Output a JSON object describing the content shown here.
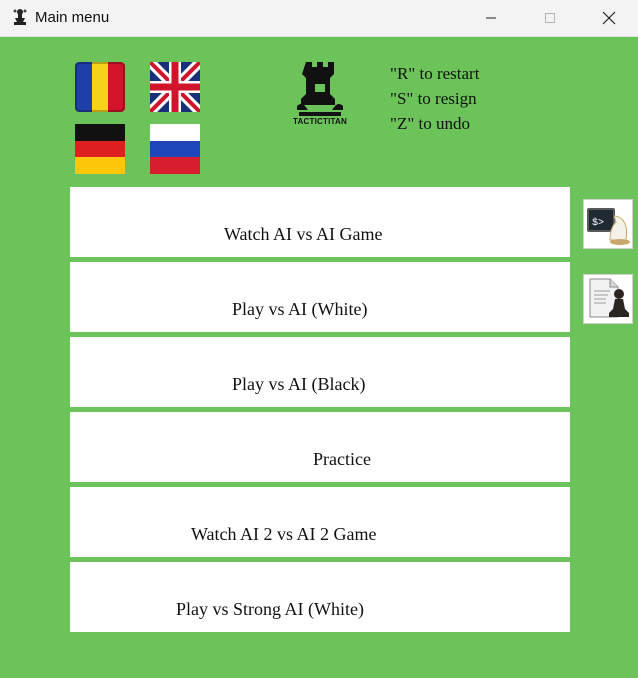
{
  "window": {
    "title": "Main menu",
    "controls": [
      "minimize",
      "maximize",
      "close"
    ]
  },
  "languages": [
    {
      "name": "romanian",
      "icon": "romania-flag-icon"
    },
    {
      "name": "english",
      "icon": "uk-flag-icon"
    },
    {
      "name": "german",
      "icon": "germany-flag-icon"
    },
    {
      "name": "russian",
      "icon": "russia-flag-icon"
    }
  ],
  "logo": {
    "text": "TACTICTITAN",
    "icon": "rook-icon"
  },
  "hints": [
    "\"R\" to restart",
    "\"S\" to resign",
    "\"Z\" to undo"
  ],
  "menu": [
    "Watch AI vs AI Game",
    "Play vs AI (White)",
    "Play vs AI (Black)",
    "Practice",
    "Watch AI 2 vs AI 2 Game",
    "Play vs Strong AI (White)"
  ],
  "side_buttons": [
    {
      "icon": "terminal-knight-icon"
    },
    {
      "icon": "document-pawn-icon"
    }
  ],
  "colors": {
    "background": "#6cc35a",
    "button": "#ffffff",
    "titlebar": "#f3f3f3"
  }
}
